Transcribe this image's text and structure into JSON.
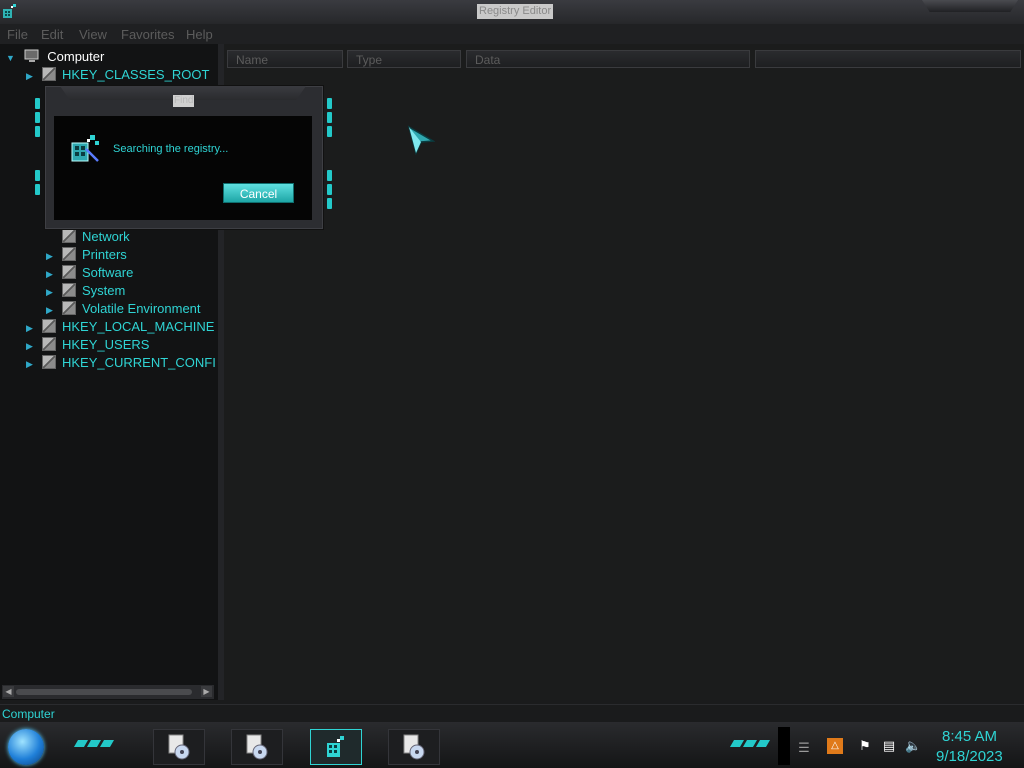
{
  "window": {
    "title": "Registry Editor"
  },
  "menu": [
    "File",
    "Edit",
    "View",
    "Favorites",
    "Help"
  ],
  "tree": {
    "root": "Computer",
    "items": [
      {
        "label": "HKEY_CLASSES_ROOT",
        "level": 1,
        "expanded": false
      },
      {
        "label": "Network",
        "level": 2,
        "expanded": false
      },
      {
        "label": "Printers",
        "level": 2,
        "expanded": false
      },
      {
        "label": "Software",
        "level": 2,
        "expanded": false
      },
      {
        "label": "System",
        "level": 2,
        "expanded": false
      },
      {
        "label": "Volatile Environment",
        "level": 2,
        "expanded": false
      },
      {
        "label": "HKEY_LOCAL_MACHINE",
        "level": 1,
        "expanded": false
      },
      {
        "label": "HKEY_USERS",
        "level": 1,
        "expanded": false
      },
      {
        "label": "HKEY_CURRENT_CONFI",
        "level": 1,
        "expanded": false
      }
    ]
  },
  "columns": [
    "Name",
    "Type",
    "Data"
  ],
  "status_bar": "Computer",
  "find_dialog": {
    "title": "Find",
    "message": "Searching the registry...",
    "cancel_label": "Cancel"
  },
  "clock": {
    "time": "8:45 AM",
    "date": "9/18/2023"
  },
  "colors": {
    "accent": "#2fd4d4",
    "background": "#1a1b1c",
    "tree_bg": "#121314"
  }
}
